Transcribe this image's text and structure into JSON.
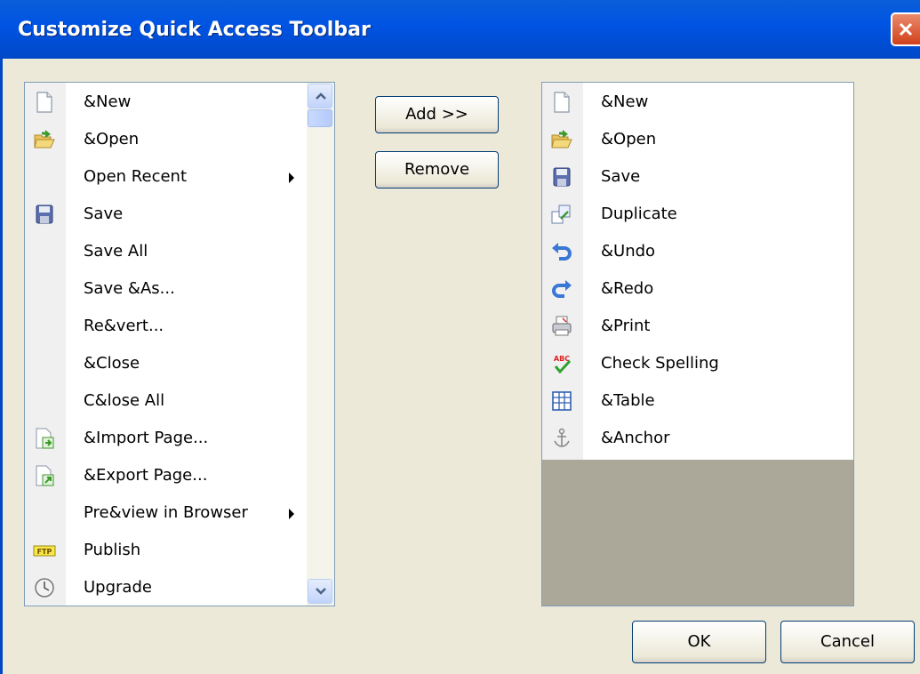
{
  "window": {
    "title": "Customize Quick Access Toolbar",
    "close_icon": "close-icon"
  },
  "left_list": {
    "items": [
      {
        "label": "&New",
        "icon": "new-document-icon",
        "submenu": false
      },
      {
        "label": "&Open",
        "icon": "open-folder-icon",
        "submenu": false
      },
      {
        "label": "Open Recent",
        "icon": "",
        "submenu": true
      },
      {
        "label": "Save",
        "icon": "save-disk-icon",
        "submenu": false
      },
      {
        "label": "Save All",
        "icon": "",
        "submenu": false
      },
      {
        "label": "Save &As...",
        "icon": "",
        "submenu": false
      },
      {
        "label": "Re&vert...",
        "icon": "",
        "submenu": false
      },
      {
        "label": "&Close",
        "icon": "",
        "submenu": false
      },
      {
        "label": "C&lose All",
        "icon": "",
        "submenu": false
      },
      {
        "label": "&Import Page...",
        "icon": "import-page-icon",
        "submenu": false
      },
      {
        "label": "&Export Page...",
        "icon": "export-page-icon",
        "submenu": false
      },
      {
        "label": "Pre&view in Browser",
        "icon": "",
        "submenu": true
      },
      {
        "label": "Publish",
        "icon": "ftp-icon",
        "submenu": false
      },
      {
        "label": "Upgrade",
        "icon": "clock-icon",
        "submenu": false
      }
    ]
  },
  "right_list": {
    "items": [
      {
        "label": "&New",
        "icon": "new-document-icon"
      },
      {
        "label": "&Open",
        "icon": "open-folder-icon"
      },
      {
        "label": "Save",
        "icon": "save-disk-icon"
      },
      {
        "label": "Duplicate",
        "icon": "duplicate-icon"
      },
      {
        "label": "&Undo",
        "icon": "undo-icon"
      },
      {
        "label": "&Redo",
        "icon": "redo-icon"
      },
      {
        "label": "&Print",
        "icon": "printer-icon"
      },
      {
        "label": "Check Spelling",
        "icon": "spellcheck-icon"
      },
      {
        "label": "&Table",
        "icon": "table-icon"
      },
      {
        "label": "&Anchor",
        "icon": "anchor-icon"
      }
    ]
  },
  "buttons": {
    "add": "Add >>",
    "remove": "Remove",
    "ok": "OK",
    "cancel": "Cancel"
  },
  "colors": {
    "titlebar": "#0054e3",
    "dialog_bg": "#ece9d8",
    "empty_area": "#aca899",
    "close": "#d1411b"
  }
}
